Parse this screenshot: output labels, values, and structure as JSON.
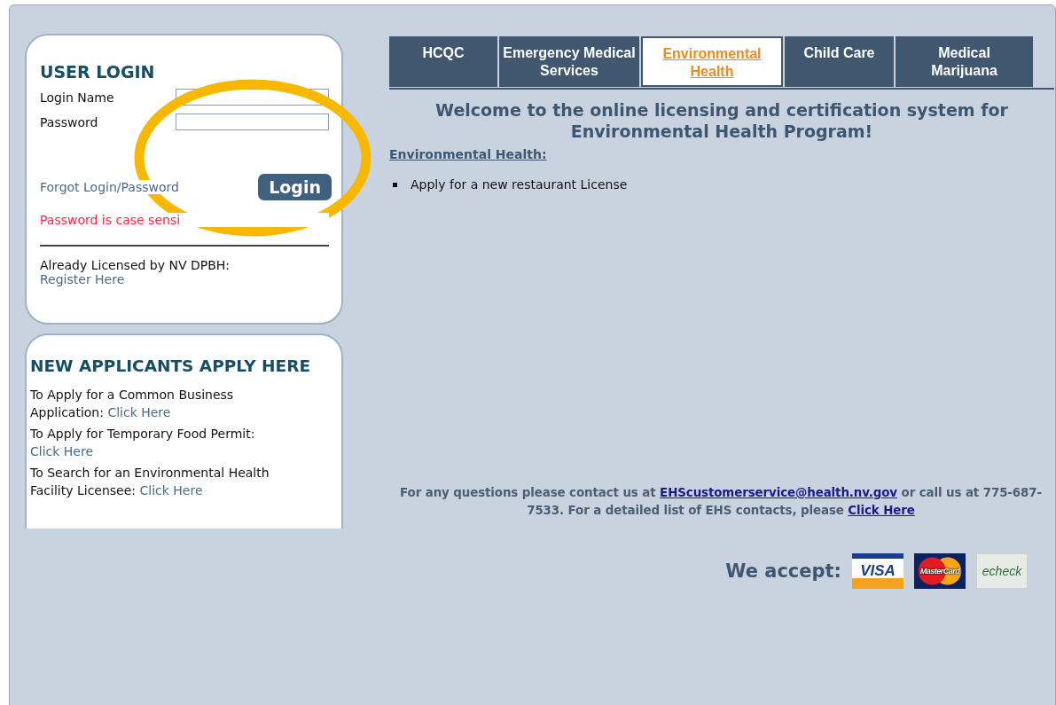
{
  "login": {
    "title": "USER LOGIN",
    "fields": [
      {
        "label": "Login Name"
      },
      {
        "label": "Password"
      }
    ],
    "forgot_link": "Forgot Login/Password",
    "button": "Login",
    "note": "Password is case sensi",
    "registered_text": "Already Licensed by NV DPBH:",
    "register_link": "Register Here"
  },
  "applicants": {
    "title": "NEW APPLICANTS APPLY HERE",
    "items": [
      {
        "text": "To Apply for a Common Business Application:",
        "link": "Click Here"
      },
      {
        "text": "To Apply for Temporary Food Permit:",
        "link": "Click Here"
      },
      {
        "text": "To Search for an Environmental Health Facility Licensee:",
        "link": "Click Here"
      }
    ]
  },
  "tabs": [
    {
      "label": "HCQC",
      "selected": false
    },
    {
      "label": "Emergency Medical Services",
      "selected": false
    },
    {
      "label": "Environmental Health",
      "selected": true
    },
    {
      "label": "Child Care",
      "selected": false
    },
    {
      "label": "Medical Marijuana",
      "selected": false
    }
  ],
  "welcome": "Welcome to the online licensing and certification system for Environmental Health Program!",
  "section_title": "Environmental Health:",
  "bullets": [
    "Apply for a new restaurant License"
  ],
  "contact": {
    "before": "For any questions please contact us at",
    "email": "EHScustomerservice@health.nv.gov",
    "middle": "or call us at 775-687-7533. For a detailed list of EHS contacts, please",
    "link": "Click Here"
  },
  "accept_label": "We accept:",
  "payment_methods": [
    {
      "kind": "visa",
      "label": "VISA"
    },
    {
      "kind": "mastercard",
      "label": "MasterCard"
    },
    {
      "kind": "echeck",
      "label": "echeck"
    }
  ]
}
